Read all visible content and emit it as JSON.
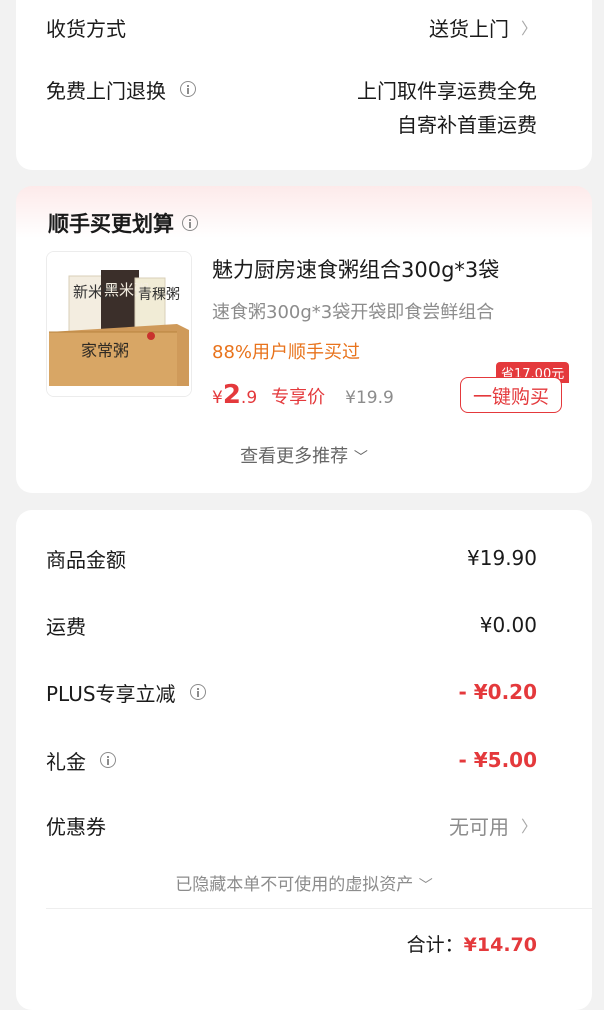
{
  "delivery": {
    "method_label": "收货方式",
    "method_value": "送货上门",
    "return_label": "免费上门退换",
    "return_value_line1": "上门取件享运费全免",
    "return_value_line2": "自寄补首重运费"
  },
  "recommend": {
    "title": "顺手买更划算",
    "product": {
      "name": "魅力厨房速食粥组合300g*3袋",
      "desc": "速食粥300g*3袋开袋即食尝鲜组合",
      "tag": "88%用户顺手买过",
      "price_symbol": "¥",
      "price_int": "2",
      "price_dec": ".9",
      "price_tag": "专享价",
      "original_price": "¥19.9",
      "save_badge": "省17.00元",
      "buy_button": "一键购买",
      "image_texts": [
        "新米粥",
        "黑米粥",
        "青稞粥",
        "家常粥"
      ]
    },
    "more_label": "查看更多推荐"
  },
  "summary": {
    "rows": [
      {
        "label": "商品金额",
        "value": "¥19.90"
      },
      {
        "label": "运费",
        "value": "¥0.00"
      },
      {
        "label": "PLUS专享立减",
        "value": "- ¥0.20"
      },
      {
        "label": "礼金",
        "value": "- ¥5.00"
      },
      {
        "label": "优惠券",
        "value": "无可用"
      }
    ],
    "hidden_note": "已隐藏本单不可使用的虚拟资产",
    "total_label": "合计：",
    "total_value": "¥14.70"
  },
  "colors": {
    "accent_red": "#e4393c",
    "orange": "#e8731c",
    "muted": "#8c8c8c"
  }
}
